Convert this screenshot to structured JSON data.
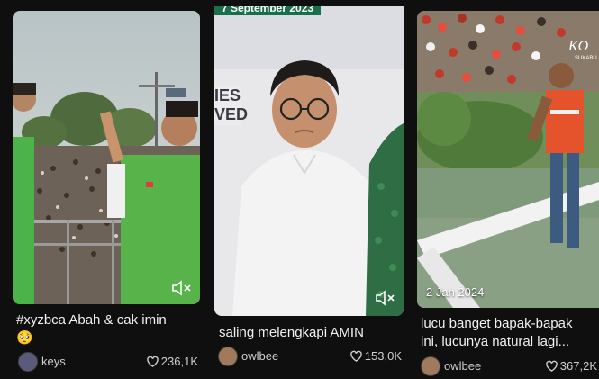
{
  "cards": [
    {
      "caption": "#xyzbca Abah & cak imin",
      "emoji": "🥺",
      "username": "keys",
      "likes": "236,1K"
    },
    {
      "overlay_text": "7 September 2023",
      "caption": "saling melengkapi AMIN",
      "username": "owlbee",
      "likes": "153,0K"
    },
    {
      "date": "2 Jan 2024",
      "watermark": "KO",
      "watermark_sub": "SUKABU",
      "caption_line1": "lucu banget bapak-bapak",
      "caption_line2": "ini, lucunya natural lagi...",
      "username": "owlbee",
      "likes": "367,2K"
    }
  ],
  "icons": {
    "mute": "speaker-muted-icon",
    "like": "heart-outline-icon"
  }
}
